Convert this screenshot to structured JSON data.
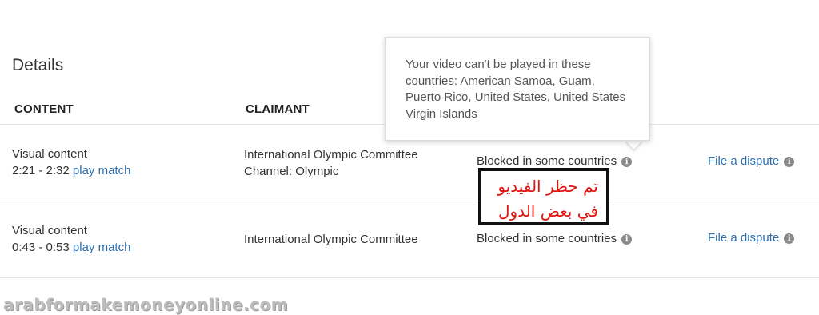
{
  "title": "Details",
  "columns": {
    "content": "CONTENT",
    "claimant": "CLAIMANT"
  },
  "rows": [
    {
      "content_type": "Visual content",
      "time_range": "2:21 - 2:32",
      "match_link": "play match",
      "claimant_name": "International Olympic Committee",
      "claimant_channel": "Channel: Olympic",
      "status": "Blocked in some countries",
      "action": "File a dispute"
    },
    {
      "content_type": "Visual content",
      "time_range": "0:43 - 0:53",
      "match_link": "play match",
      "claimant_name": "International Olympic Committee",
      "claimant_channel": "",
      "status": "Blocked in some countries",
      "action": "File a dispute"
    }
  ],
  "tooltip": {
    "text": "Your video can't be played in these countries: American Samoa, Guam, Puerto Rico, United States, United States Virgin Islands"
  },
  "annotation": {
    "line1": "تم حظر الفيديو",
    "line2": "في بعض الدول"
  },
  "watermark": "arabformakemoneyonline.com",
  "icons": {
    "info": "info-icon"
  },
  "colors": {
    "link": "#2c6fb0",
    "annotation_text": "#e0140f"
  }
}
